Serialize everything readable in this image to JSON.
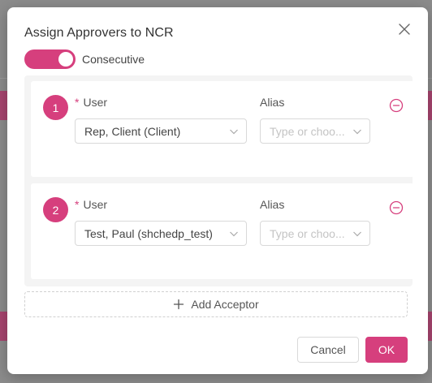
{
  "modal": {
    "title": "Assign Approvers to NCR",
    "close_icon": "close-icon"
  },
  "toggle": {
    "label": "Consecutive",
    "on": true,
    "color": "#d63f7d"
  },
  "approvers": [
    {
      "step": "1",
      "user_label": "User",
      "required_mark": "*",
      "user_value": "Rep, Client (Client)",
      "alias_label": "Alias",
      "alias_placeholder": "Type or choo..."
    },
    {
      "step": "2",
      "user_label": "User",
      "required_mark": "*",
      "user_value": "Test, Paul (shchedp_test)",
      "alias_label": "Alias",
      "alias_placeholder": "Type or choo..."
    }
  ],
  "add_acceptor": {
    "label": "Add Acceptor"
  },
  "footer": {
    "cancel_label": "Cancel",
    "ok_label": "OK"
  },
  "colors": {
    "accent": "#d63f7d",
    "overlay": "#8c8c8c"
  }
}
